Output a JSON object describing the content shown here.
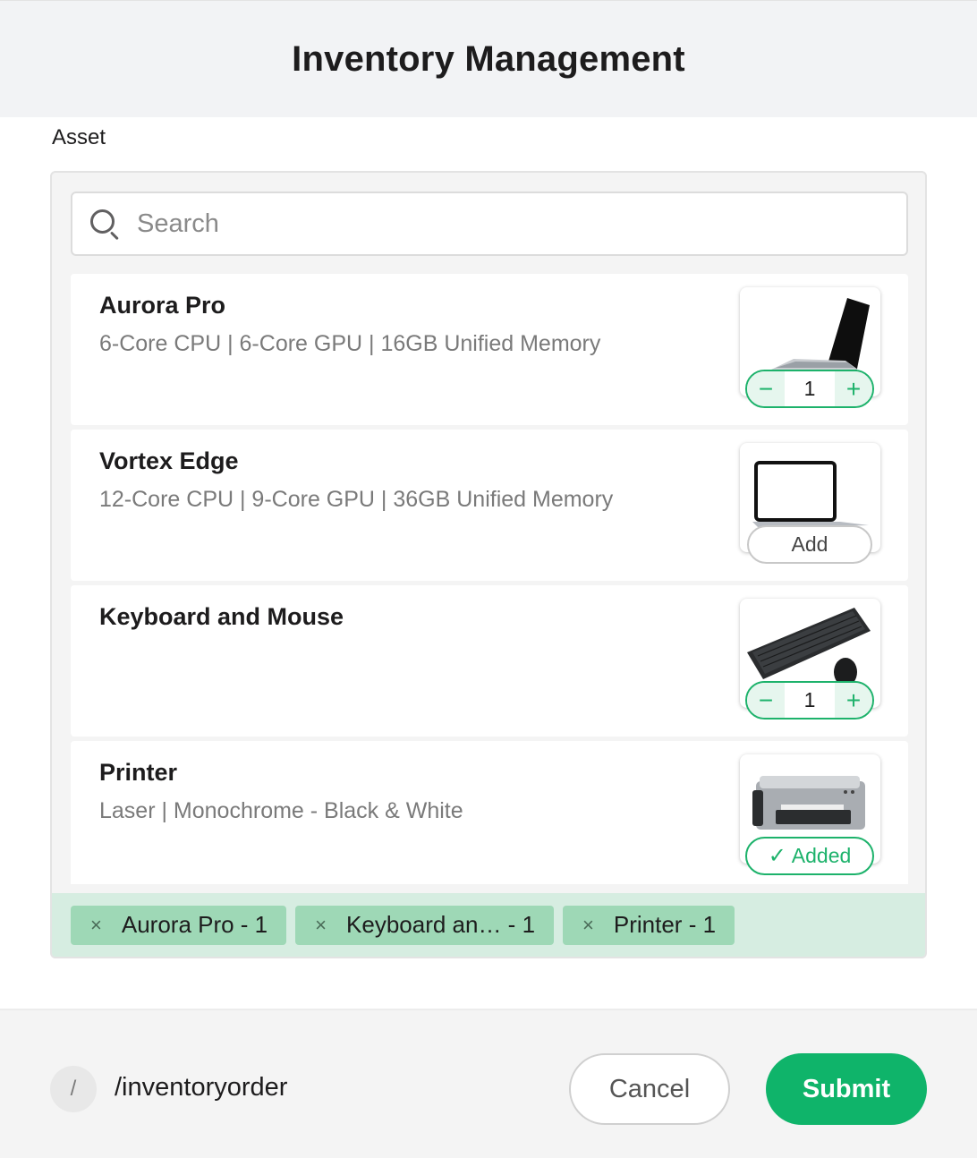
{
  "header": {
    "title": "Inventory Management"
  },
  "section": {
    "label": "Asset"
  },
  "search": {
    "placeholder": "Search",
    "icon": "search-icon"
  },
  "items": [
    {
      "title": "Aurora Pro",
      "desc": "6-Core CPU | 6-Core GPU | 16GB Unified Memory",
      "image": "laptop-open-icon",
      "state": "stepper",
      "quantity": "1",
      "minus": "−",
      "plus": "+"
    },
    {
      "title": "Vortex Edge",
      "desc": "12-Core CPU | 9-Core GPU | 36GB Unified Memory",
      "image": "laptop-white-icon",
      "state": "add",
      "add_label": "Add"
    },
    {
      "title": "Keyboard and Mouse",
      "desc": "",
      "image": "keyboard-mouse-icon",
      "state": "stepper",
      "quantity": "1",
      "minus": "−",
      "plus": "+"
    },
    {
      "title": "Printer",
      "desc": "Laser | Monochrome - Black & White",
      "image": "printer-icon",
      "state": "added",
      "added_label": "Added",
      "check": "✓"
    }
  ],
  "selected": [
    {
      "label": "Aurora Pro - 1",
      "remove": "×"
    },
    {
      "label": "Keyboard an…  - 1",
      "remove": "×"
    },
    {
      "label": "Printer - 1",
      "remove": "×"
    }
  ],
  "footer": {
    "slash": "/",
    "command": "/inventoryorder",
    "cancel_label": "Cancel",
    "submit_label": "Submit"
  },
  "colors": {
    "accent": "#0fb46a",
    "chip_bg": "#9ed8b6",
    "chips_bar_bg": "#d6ede1"
  }
}
